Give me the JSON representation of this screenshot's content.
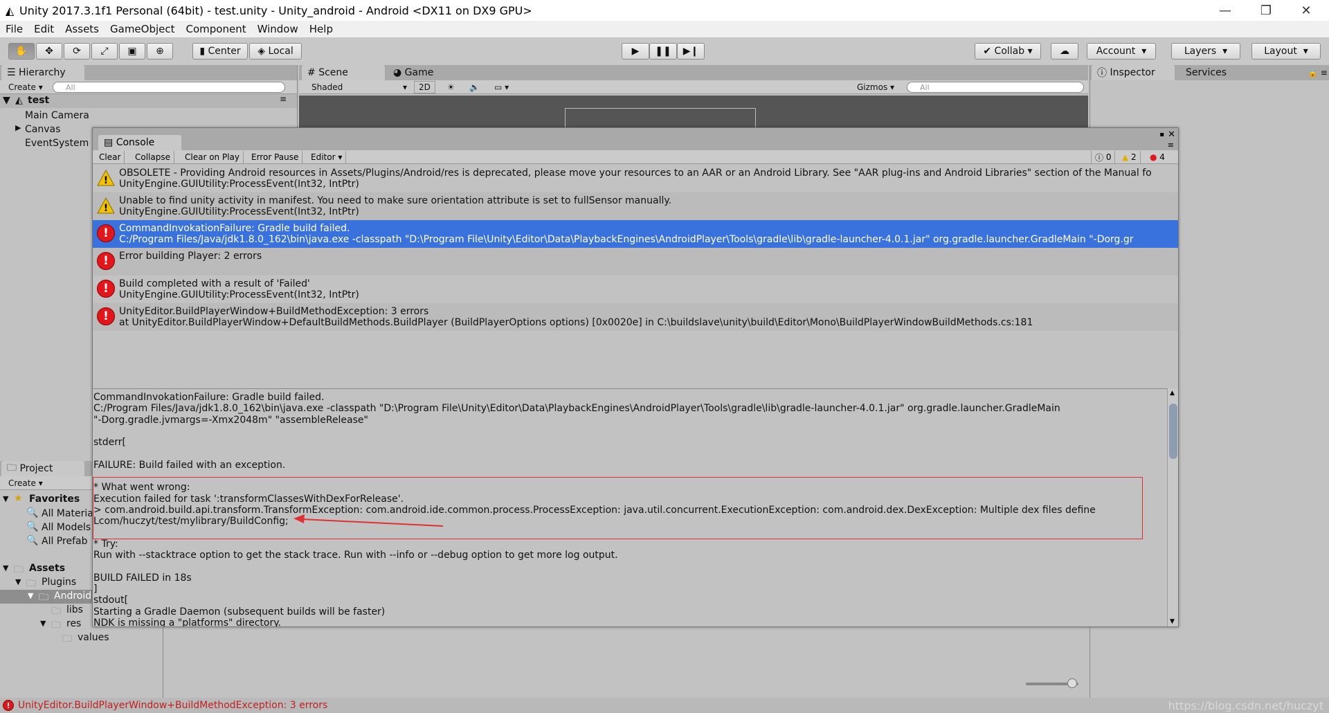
{
  "window": {
    "title": "Unity 2017.3.1f1 Personal (64bit) - test.unity - Unity_android - Android <DX11 on DX9 GPU>"
  },
  "menu": [
    "File",
    "Edit",
    "Assets",
    "GameObject",
    "Component",
    "Window",
    "Help"
  ],
  "toolbar": {
    "pivot": "Center",
    "space": "Local",
    "collab": "Collab",
    "account": "Account",
    "layers": "Layers",
    "layout": "Layout"
  },
  "hierarchy": {
    "tab": "Hierarchy",
    "create": "Create",
    "search_placeholder": "All",
    "scene": "test",
    "items": [
      "Main Camera",
      "Canvas",
      "EventSystem"
    ]
  },
  "scene_view": {
    "tab_scene": "Scene",
    "tab_game": "Game",
    "shading": "Shaded",
    "mode_2d": "2D",
    "gizmos": "Gizmos",
    "search_placeholder": "All"
  },
  "inspector": {
    "tab": "Inspector",
    "services": "Services"
  },
  "project": {
    "tab": "Project",
    "create": "Create",
    "favorites": "Favorites",
    "fav_items": [
      "All Materia",
      "All Models",
      "All Prefab"
    ],
    "assets": "Assets",
    "plugins": "Plugins",
    "android": "Android",
    "libs": "libs",
    "res": "res",
    "values": "values"
  },
  "console": {
    "tab": "Console",
    "buttons": [
      "Clear",
      "Collapse",
      "Clear on Play",
      "Error Pause",
      "Editor"
    ],
    "counts": {
      "info": "0",
      "warn": "2",
      "error": "4"
    },
    "entries": [
      {
        "type": "warn",
        "line1": "OBSOLETE - Providing Android resources in Assets/Plugins/Android/res is deprecated, please move your resources to an AAR or an Android Library. See \"AAR plug-ins and Android Libraries\" section of the Manual fo",
        "line2": "UnityEngine.GUIUtility:ProcessEvent(Int32, IntPtr)"
      },
      {
        "type": "warn",
        "line1": "Unable to find unity activity in manifest. You need to make sure orientation attribute is set to fullSensor manually.",
        "line2": "UnityEngine.GUIUtility:ProcessEvent(Int32, IntPtr)"
      },
      {
        "type": "error",
        "line1": "CommandInvokationFailure: Gradle build failed.",
        "line2": "C:/Program Files/Java/jdk1.8.0_162\\bin\\java.exe -classpath \"D:\\Program File\\Unity\\Editor\\Data\\PlaybackEngines\\AndroidPlayer\\Tools\\gradle\\lib\\gradle-launcher-4.0.1.jar\" org.gradle.launcher.GradleMain \"-Dorg.gr"
      },
      {
        "type": "error",
        "line1": "Error building Player: 2 errors",
        "line2": ""
      },
      {
        "type": "error",
        "line1": "Build completed with a result of 'Failed'",
        "line2": "UnityEngine.GUIUtility:ProcessEvent(Int32, IntPtr)"
      },
      {
        "type": "error",
        "line1": "UnityEditor.BuildPlayerWindow+BuildMethodException: 3 errors",
        "line2": "  at UnityEditor.BuildPlayerWindow+DefaultBuildMethods.BuildPlayer (BuildPlayerOptions options) [0x0020e] in C:\\buildslave\\unity\\build\\Editor\\Mono\\BuildPlayerWindowBuildMethods.cs:181"
      }
    ],
    "detail": "CommandInvokationFailure: Gradle build failed.\nC:/Program Files/Java/jdk1.8.0_162\\bin\\java.exe -classpath \"D:\\Program File\\Unity\\Editor\\Data\\PlaybackEngines\\AndroidPlayer\\Tools\\gradle\\lib\\gradle-launcher-4.0.1.jar\" org.gradle.launcher.GradleMain\n\"-Dorg.gradle.jvmargs=-Xmx2048m\" \"assembleRelease\"\n\nstderr[\n\nFAILURE: Build failed with an exception.\n\n* What went wrong:\nExecution failed for task ':transformClassesWithDexForRelease'.\n> com.android.build.api.transform.TransformException: com.android.ide.common.process.ProcessException: java.util.concurrent.ExecutionException: com.android.dex.DexException: Multiple dex files define\nLcom/huczyt/test/mylibrary/BuildConfig;\n\n* Try:\nRun with --stacktrace option to get the stack trace. Run with --info or --debug option to get more log output.\n\nBUILD FAILED in 18s\n]\nstdout[\nStarting a Gradle Daemon (subsequent builds will be faster)\nNDK is missing a \"platforms\" directory."
  },
  "statusbar": "UnityEditor.BuildPlayerWindow+BuildMethodException: 3 errors",
  "watermark": "https://blog.csdn.net/huczyt",
  "colors": {
    "selection": "#3a72dd",
    "error": "#e1171b",
    "warning": "#f2c200",
    "highlight_box": "#e03030"
  }
}
